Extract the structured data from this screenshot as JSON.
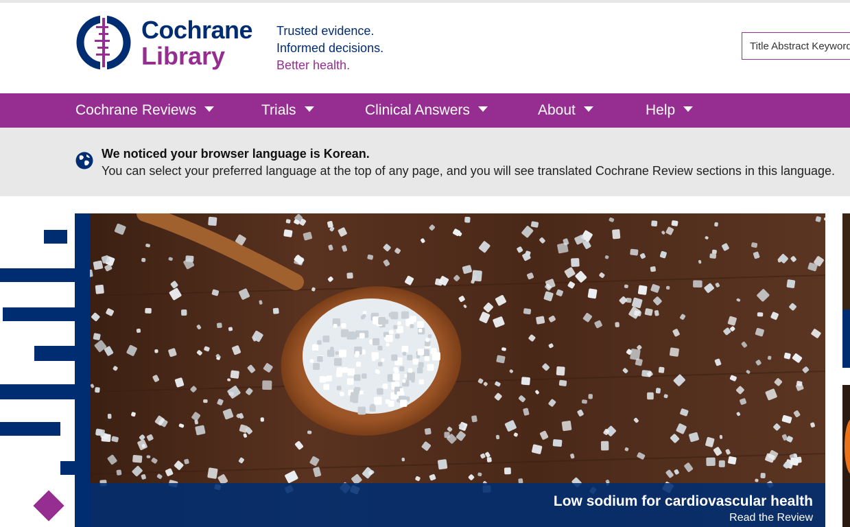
{
  "header": {
    "brand_line1": "Cochrane",
    "brand_line2": "Library",
    "tagline1": "Trusted evidence.",
    "tagline2": "Informed decisions.",
    "tagline3": "Better health.",
    "search_placeholder": "Title Abstract Keyword"
  },
  "nav": {
    "items": [
      {
        "label": "Cochrane Reviews"
      },
      {
        "label": "Trials"
      },
      {
        "label": "Clinical Answers"
      },
      {
        "label": "About"
      },
      {
        "label": "Help"
      }
    ]
  },
  "notice": {
    "icon": "globe-icon",
    "title": "We noticed your browser language is Korean.",
    "body": "You can select your preferred language at the top of any page, and you will see translated Cochrane Review sections in this language."
  },
  "hero": {
    "title": "Low sodium for cardiovascular health",
    "link": "Read the Review"
  },
  "colors": {
    "navy": "#002d72",
    "purple": "#962d91",
    "notice_bg": "#e8e8e8"
  }
}
